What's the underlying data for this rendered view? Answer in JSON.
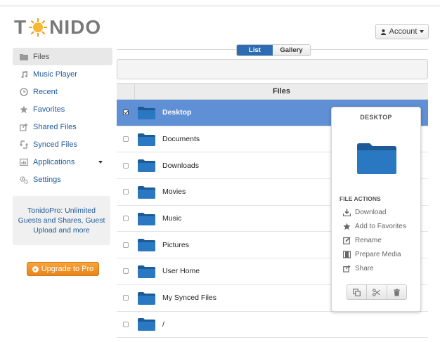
{
  "app": {
    "logo_text_prefix": "T",
    "logo_text_suffix": "NIDO",
    "brand_color": "#f39c1e",
    "accent_color": "#2d6bb3"
  },
  "header": {
    "account_label": "Account"
  },
  "sidebar": {
    "items": [
      {
        "label": "Files",
        "icon": "folder-icon"
      },
      {
        "label": "Music Player",
        "icon": "music-note-icon"
      },
      {
        "label": "Recent",
        "icon": "clock-icon"
      },
      {
        "label": "Favorites",
        "icon": "star-icon"
      },
      {
        "label": "Shared Files",
        "icon": "share-icon"
      },
      {
        "label": "Synced Files",
        "icon": "sync-icon"
      },
      {
        "label": "Applications",
        "icon": "apps-icon"
      },
      {
        "label": "Settings",
        "icon": "gears-icon"
      }
    ],
    "promo_text": "TonidoPro: Unlimited Guests and Shares, Guest Upload and more",
    "upgrade_label": "Upgrade to Pro"
  },
  "view_toggle": {
    "options": [
      "List",
      "Gallery"
    ],
    "selected": "List"
  },
  "table": {
    "header": "Files",
    "rows": [
      {
        "name": "Desktop",
        "selected": true
      },
      {
        "name": "Documents",
        "selected": false
      },
      {
        "name": "Downloads",
        "selected": false
      },
      {
        "name": "Movies",
        "selected": false
      },
      {
        "name": "Music",
        "selected": false
      },
      {
        "name": "Pictures",
        "selected": false
      },
      {
        "name": "User Home",
        "selected": false
      },
      {
        "name": "My Synced Files",
        "selected": false
      },
      {
        "name": "/",
        "selected": false
      }
    ]
  },
  "details": {
    "title": "DESKTOP",
    "actions_heading": "FILE ACTIONS",
    "actions": [
      {
        "label": "Download",
        "icon": "download-icon"
      },
      {
        "label": "Add to Favorites",
        "icon": "star-icon"
      },
      {
        "label": "Rename",
        "icon": "edit-icon"
      },
      {
        "label": "Prepare Media",
        "icon": "film-icon"
      },
      {
        "label": "Share",
        "icon": "share-icon"
      }
    ],
    "buttons": [
      "copy-icon",
      "scissors-icon",
      "trash-icon"
    ]
  }
}
